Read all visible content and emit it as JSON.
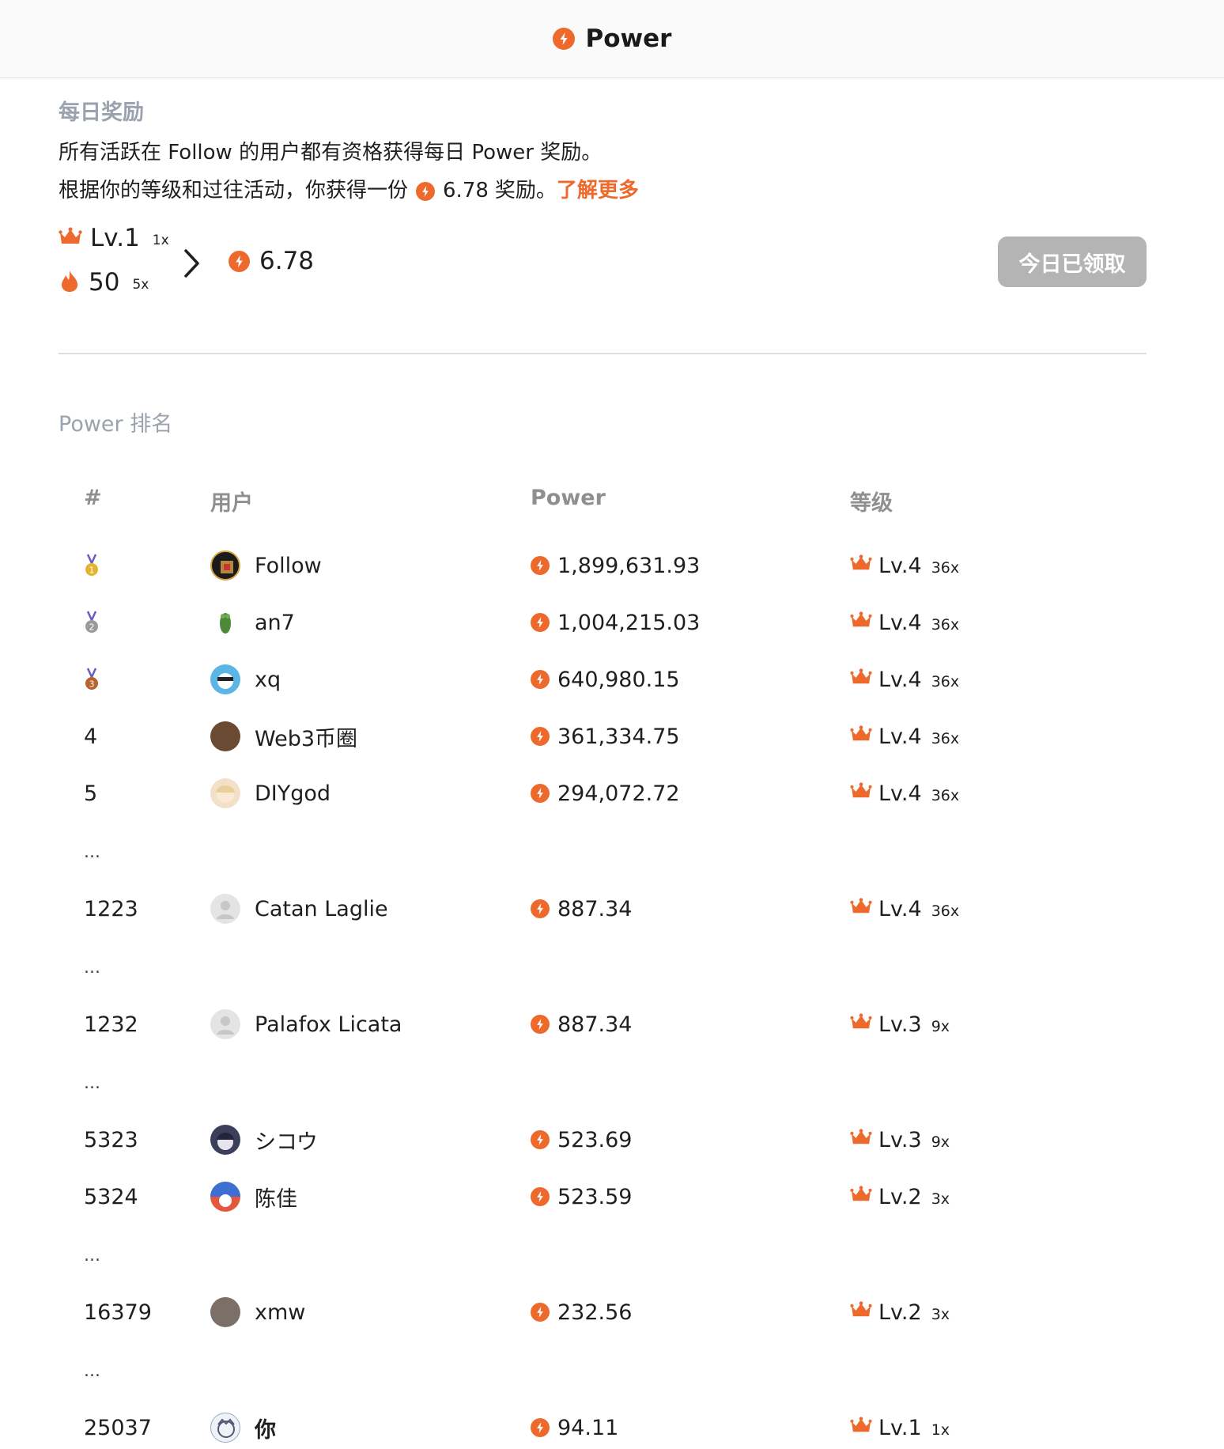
{
  "header": {
    "title": "Power",
    "icon": "power-bolt-icon"
  },
  "daily_reward": {
    "section_title": "每日奖励",
    "line1": "所有活跃在 Follow 的用户都有资格获得每日 Power 奖励。",
    "line2_prefix": "根据你的等级和过往活动，你获得一份",
    "line2_amount": "6.78",
    "line2_suffix": "奖励。",
    "learn_more": "了解更多",
    "level_label": "Lv.1",
    "level_mult": "1x",
    "streak_value": "50",
    "streak_mult": "5x",
    "total": "6.78",
    "claim_button": "今日已领取"
  },
  "ranking": {
    "section_title": "Power 排名",
    "columns": [
      "#",
      "用户",
      "Power",
      "等级"
    ],
    "rows": [
      {
        "rank": "",
        "medal": "gold",
        "user": "Follow",
        "avatar": "follow-logo",
        "power": "1,899,631.93",
        "level": "Lv.4",
        "mult": "36x"
      },
      {
        "rank": "",
        "medal": "silver",
        "user": "an7",
        "avatar": "frog",
        "power": "1,004,215.03",
        "level": "Lv.4",
        "mult": "36x"
      },
      {
        "rank": "",
        "medal": "bronze",
        "user": "xq",
        "avatar": "blue-character",
        "power": "640,980.15",
        "level": "Lv.4",
        "mult": "36x"
      },
      {
        "rank": "4",
        "medal": "",
        "user": "Web3币圈",
        "avatar": "brown",
        "power": "361,334.75",
        "level": "Lv.4",
        "mult": "36x"
      },
      {
        "rank": "5",
        "medal": "",
        "user": "DIYgod",
        "avatar": "anime-girl",
        "power": "294,072.72",
        "level": "Lv.4",
        "mult": "36x"
      },
      {
        "rank": "...",
        "ellipsis": true
      },
      {
        "rank": "1223",
        "medal": "",
        "user": "Catan Laglie",
        "avatar": "default",
        "power": "887.34",
        "level": "Lv.4",
        "mult": "36x"
      },
      {
        "rank": "...",
        "ellipsis": true
      },
      {
        "rank": "1232",
        "medal": "",
        "user": "Palafox Licata",
        "avatar": "default",
        "power": "887.34",
        "level": "Lv.3",
        "mult": "9x"
      },
      {
        "rank": "...",
        "ellipsis": true
      },
      {
        "rank": "5323",
        "medal": "",
        "user": "シコウ",
        "avatar": "dark-anime",
        "power": "523.69",
        "level": "Lv.3",
        "mult": "9x"
      },
      {
        "rank": "5324",
        "medal": "",
        "user": "陈佳",
        "avatar": "red-blue",
        "power": "523.59",
        "level": "Lv.2",
        "mult": "3x"
      },
      {
        "rank": "...",
        "ellipsis": true
      },
      {
        "rank": "16379",
        "medal": "",
        "user": "xmw",
        "avatar": "photo",
        "power": "232.56",
        "level": "Lv.2",
        "mult": "3x"
      },
      {
        "rank": "...",
        "ellipsis": true
      },
      {
        "rank": "25037",
        "medal": "",
        "user": "你",
        "avatar": "sketch",
        "power": "94.11",
        "level": "Lv.1",
        "mult": "1x",
        "bold_user": true
      }
    ]
  },
  "colors": {
    "accent": "#ee6a2c",
    "label_gray": "#9aa3ad",
    "button_disabled": "#b4b4b4"
  }
}
